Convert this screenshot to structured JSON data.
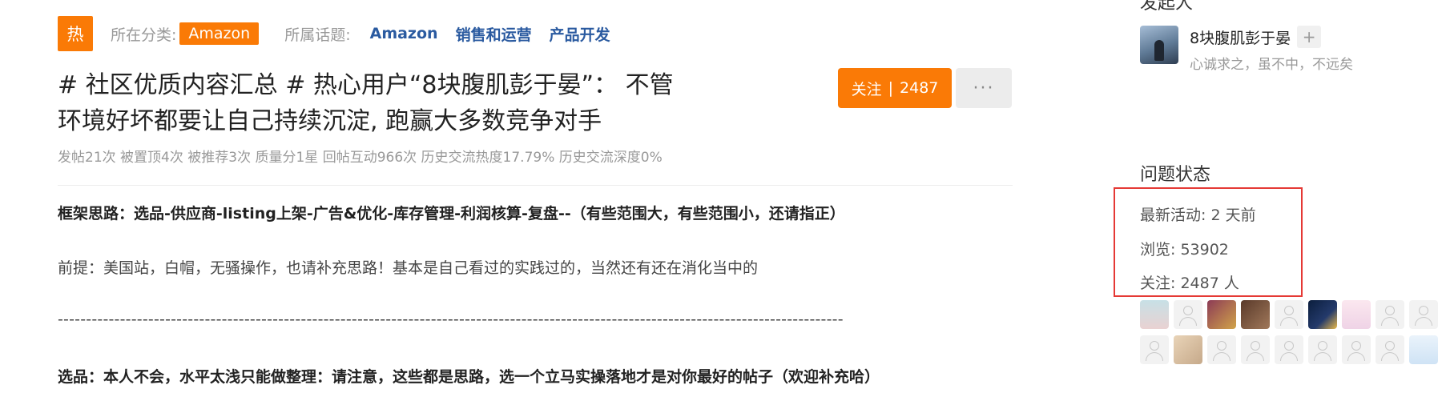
{
  "header": {
    "hot_badge": "热",
    "category_label": "所在分类:",
    "category_value": "Amazon",
    "topics_label": "所属话题:",
    "topics": [
      "Amazon",
      "销售和运营",
      "产品开发"
    ]
  },
  "post": {
    "title": "# 社区优质内容汇总 # 热心用户“8块腹肌彭于晏”： 不管环境好坏都要让自己持续沉淀, 跑赢大多数竞争对手",
    "stats": "发帖21次 被置顶4次 被推荐3次 质量分1星 回帖互动966次 历史交流热度17.79% 历史交流深度0%",
    "follow_label": "关注",
    "follow_count": "2487",
    "more_label": "···"
  },
  "content": {
    "p1": "框架思路：选品-供应商-listing上架-广告&优化-库存管理-利润核算-复盘--（有些范围大，有些范围小，还请指正）",
    "p2": "前提：美国站，白帽，无骚操作，也请补充思路！基本是自己看过的实践过的，当然还有还在消化当中的",
    "p3": "-------------------------------------------------------------------------------------------------------------------------------------------",
    "p4": "选品：本人不会，水平太浅只能做整理：请注意，这些都是思路，选一个立马实操落地才是对你最好的帖子（欢迎补充哈）"
  },
  "sidebar": {
    "partial_heading": "发起人",
    "author": {
      "name": "8块腹肌彭于晏",
      "plus": "+",
      "signature": "心诚求之，虽不中，不远矣"
    },
    "status_title": "问题状态",
    "status": {
      "latest_activity": "最新活动: 2 天前",
      "views": "浏览: 53902",
      "followers": "关注: 2487 人"
    }
  },
  "colors": {
    "accent": "#fa7a06",
    "topic_link": "#2a5aa0",
    "highlight_box": "#e53935"
  }
}
